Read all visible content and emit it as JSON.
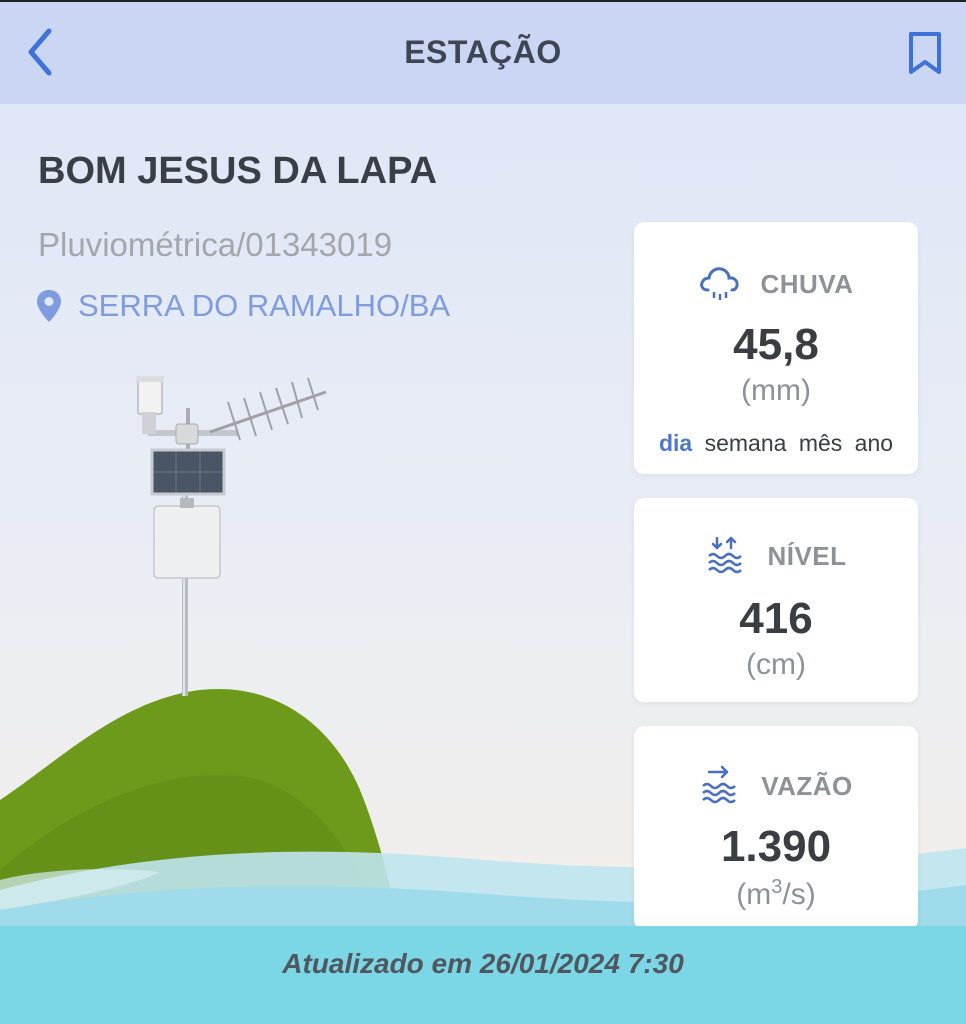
{
  "header": {
    "title": "ESTAÇÃO",
    "back_icon": "chevron-left-icon",
    "bookmark_icon": "bookmark-icon",
    "accent_color": "#3f72d9"
  },
  "station": {
    "name": "BOM JESUS DA LAPA",
    "type_code": "Pluviométrica/01343019",
    "location": "SERRA DO RAMALHO/BA",
    "location_icon": "map-pin-icon"
  },
  "cards": {
    "chuva": {
      "label": "CHUVA",
      "icon": "rain-cloud-icon",
      "value": "45,8",
      "unit": "(mm)",
      "periods": [
        "dia",
        "semana",
        "mês",
        "ano"
      ],
      "active_period": "dia"
    },
    "nivel": {
      "label": "NÍVEL",
      "icon": "water-level-icon",
      "value": "416",
      "unit": "(cm)"
    },
    "vazao": {
      "label": "VAZÃO",
      "icon": "water-flow-icon",
      "value": "1.390",
      "unit_base": "(m",
      "unit_exp": "3",
      "unit_tail": "/s)"
    }
  },
  "footer": {
    "updated_text": "Atualizado em 26/01/2024 7:30"
  }
}
